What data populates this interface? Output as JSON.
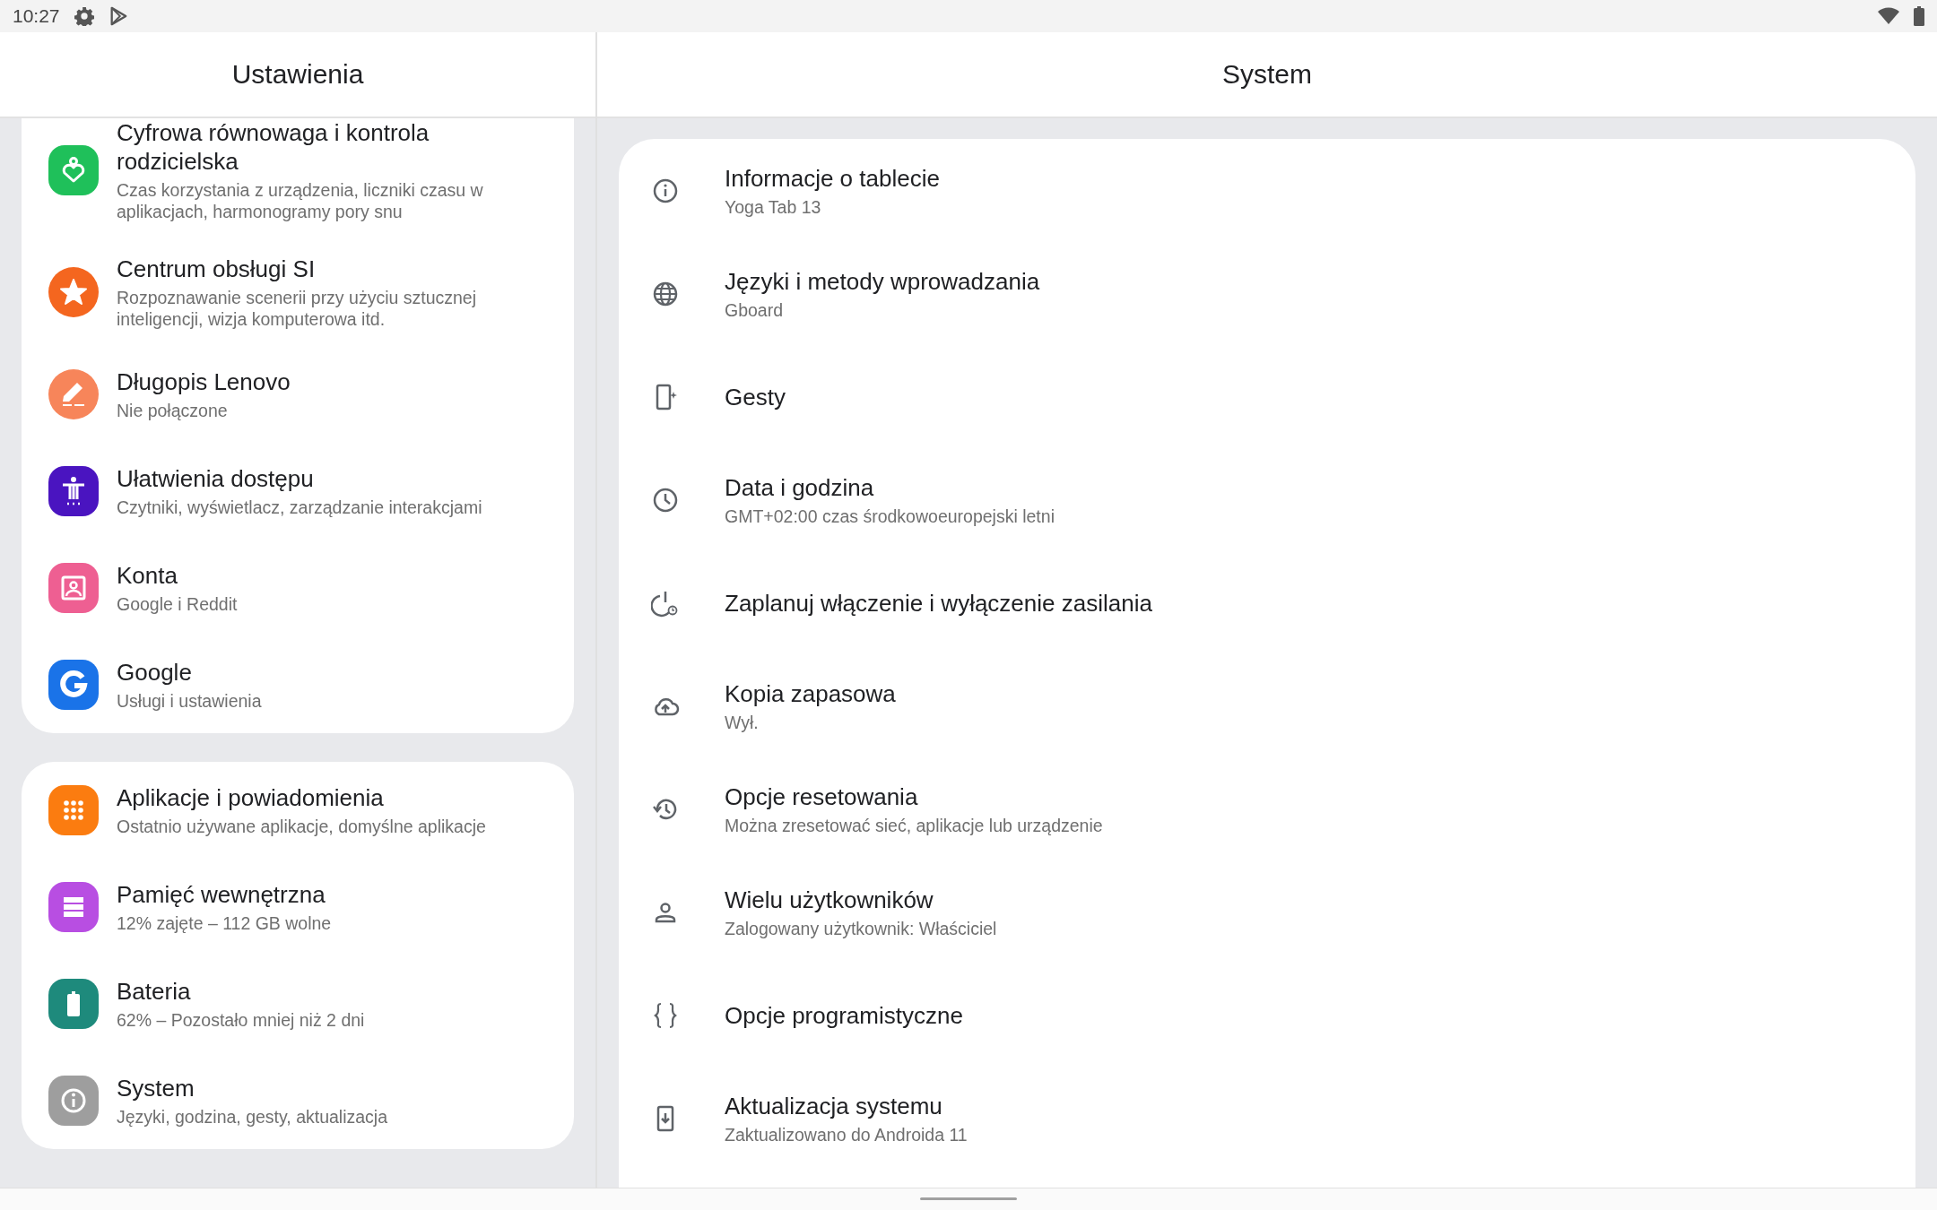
{
  "status_bar": {
    "time": "10:27"
  },
  "left_pane": {
    "title": "Ustawienia",
    "groups": [
      {
        "items": [
          {
            "title": "Cyfrowa równowaga i kontrola rodzicielska",
            "subtitle": "Czas korzystania z urządzenia, liczniki czasu w aplikacjach, harmonogramy pory snu",
            "color": "#1fc05a"
          },
          {
            "title": "Centrum obsługi SI",
            "subtitle": "Rozpoznawanie scenerii przy użyciu sztucznej inteligencji, wizja komputerowa itd.",
            "color": "#f4661f"
          },
          {
            "title": "Długopis Lenovo",
            "subtitle": "Nie połączone",
            "color": "#f7855a"
          },
          {
            "title": "Ułatwienia dostępu",
            "subtitle": "Czytniki, wyświetlacz, zarządzanie interakcjami",
            "color": "#4a14c0"
          },
          {
            "title": "Konta",
            "subtitle": "Google i Reddit",
            "color": "#ee5f92"
          },
          {
            "title": "Google",
            "subtitle": "Usługi i ustawienia",
            "color": "#1a73e8"
          }
        ]
      },
      {
        "items": [
          {
            "title": "Aplikacje i powiadomienia",
            "subtitle": "Ostatnio używane aplikacje, domyślne aplikacje",
            "color": "#fb7c10"
          },
          {
            "title": "Pamięć wewnętrzna",
            "subtitle": "12% zajęte – 112 GB wolne",
            "color": "#b84ee2"
          },
          {
            "title": "Bateria",
            "subtitle": "62% – Pozostało mniej niż 2 dni",
            "color": "#1e8a7c"
          },
          {
            "title": "System",
            "subtitle": "Języki, godzina, gesty, aktualizacja",
            "color": "#9e9e9e"
          }
        ]
      }
    ]
  },
  "right_pane": {
    "title": "System",
    "items": [
      {
        "title": "Informacje o tablecie",
        "subtitle": "Yoga Tab 13"
      },
      {
        "title": "Języki i metody wprowadzania",
        "subtitle": "Gboard"
      },
      {
        "title": "Gesty"
      },
      {
        "title": "Data i godzina",
        "subtitle": "GMT+02:00 czas środkowoeuropejski letni"
      },
      {
        "title": "Zaplanuj włączenie i wyłączenie zasilania"
      },
      {
        "title": "Kopia zapasowa",
        "subtitle": "Wył."
      },
      {
        "title": "Opcje resetowania",
        "subtitle": "Można zresetować sieć, aplikacje lub urządzenie"
      },
      {
        "title": "Wielu użytkowników",
        "subtitle": "Zalogowany użytkownik: Właściciel"
      },
      {
        "title": "Opcje programistyczne"
      },
      {
        "title": "Aktualizacja systemu",
        "subtitle": "Zaktualizowano do Androida 11"
      }
    ]
  }
}
